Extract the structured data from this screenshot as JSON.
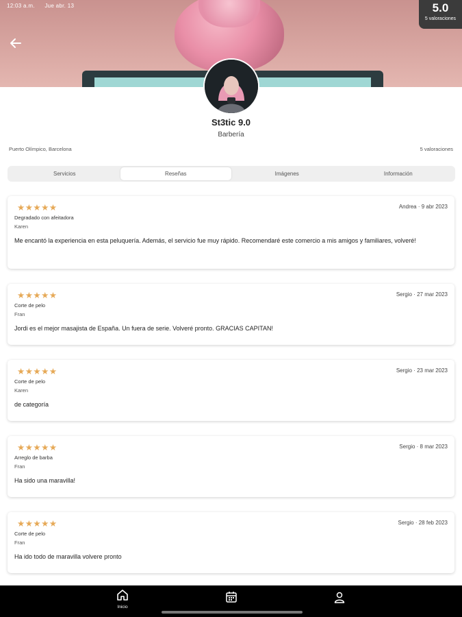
{
  "status_bar": {
    "time": "12:03 a.m.",
    "date": "Jue abr. 13"
  },
  "rating": {
    "score": "5.0",
    "count_label": "5 valoraciones"
  },
  "business": {
    "name": "St3tic 9.0",
    "category": "Barbería",
    "location": "Puerto Olímpico, Barcelona",
    "reviews_count": "5 valoraciones"
  },
  "tabs": [
    {
      "label": "Servicios",
      "active": false
    },
    {
      "label": "Reseñas",
      "active": true
    },
    {
      "label": "Imágenes",
      "active": false
    },
    {
      "label": "Información",
      "active": false
    }
  ],
  "reviews": [
    {
      "stars": "★★★★★",
      "rating": 5,
      "author_date": "Andrea · 9 abr 2023",
      "service": "Degradado con afeitadora",
      "staff": "Karen",
      "comment": "Me encantó la experiencia en esta peluquería. Además, el servicio fue muy rápido. Recomendaré este comercio a mis amigos y familiares, volveré!"
    },
    {
      "stars": "★★★★★",
      "rating": 5,
      "author_date": "Sergio · 27 mar 2023",
      "service": "Corte de pelo",
      "staff": "Fran",
      "comment": "Jordi es el mejor masajista de España. Un fuera de serie. Volveré pronto. GRACIAS CAPITAN!"
    },
    {
      "stars": "★★★★★",
      "rating": 5,
      "author_date": "Sergio · 23 mar 2023",
      "service": "Corte de pelo",
      "staff": "Karen",
      "comment": "de categoría"
    },
    {
      "stars": "★★★★★",
      "rating": 5,
      "author_date": "Sergio · 8 mar 2023",
      "service": "Arreglo de barba",
      "staff": "Fran",
      "comment": "Ha sido una maravilla!"
    },
    {
      "stars": "★★★★★",
      "rating": 5,
      "author_date": "Sergio · 28 feb 2023",
      "service": "Corte de pelo",
      "staff": "Fran",
      "comment": "Ha ido todo de maravilla volvere pronto"
    }
  ],
  "nav": {
    "home_label": "Inicio",
    "home_icon": "home-icon",
    "calendar_icon": "calendar-icon",
    "profile_icon": "profile-icon"
  },
  "colors": {
    "accent_star": "#e6a957",
    "nav_bg": "#000000"
  }
}
